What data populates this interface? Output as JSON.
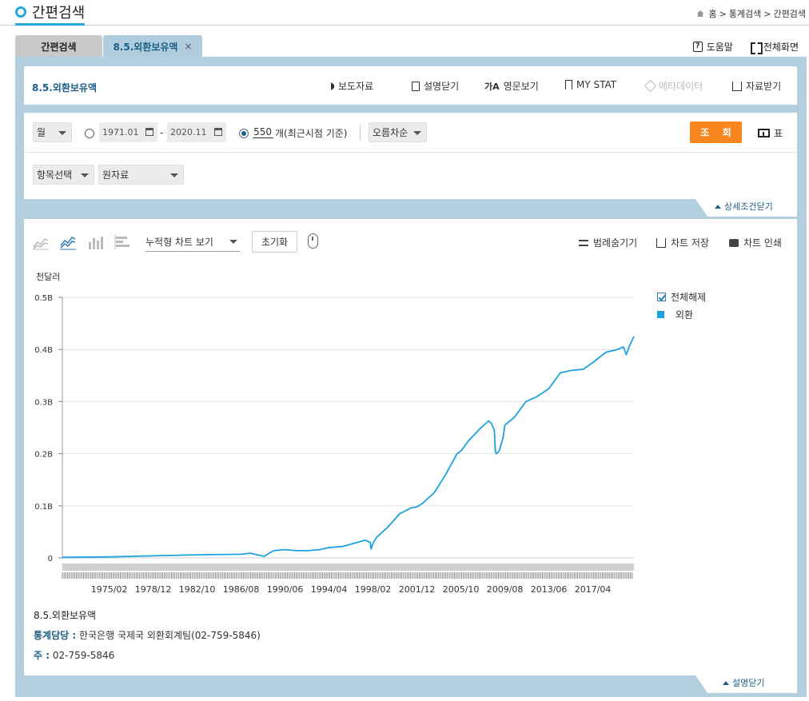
{
  "header": {
    "title": "간편검색",
    "breadcrumb": [
      "홈",
      "통계검색",
      "간편검색"
    ]
  },
  "tabs": [
    {
      "label": "간편검색",
      "active": false
    },
    {
      "label": "8.5.외환보유액",
      "active": true,
      "close": "×"
    }
  ],
  "top_actions": {
    "help": "도움말",
    "fullscreen": "전체화면"
  },
  "table_panel": {
    "title": "8.5.외환보유액",
    "tools": {
      "press": "보도자료",
      "desc_close": "설명닫기",
      "english": "영문보기",
      "my_stat": "MY STAT",
      "metadata": "메타데이터",
      "download": "자료받기"
    }
  },
  "query": {
    "period": "월",
    "date_from": "1971.01",
    "date_to": "2020.11",
    "date_separator": "-",
    "count": "550",
    "count_label": "개(최근시점 기준)",
    "sort": "오름차순",
    "search_button": "조 회",
    "table_button": "표",
    "item_select": "항목선택",
    "data_type": "원자료",
    "detail_toggle": "상세조건닫기"
  },
  "chart_toolbar": {
    "view_mode": "누적형 차트 보기",
    "reset": "초기화",
    "legend_hide": "범례숨기기",
    "save": "차트 저장",
    "print": "차트 인쇄"
  },
  "chart_data": {
    "type": "line",
    "ylabel": "천달러",
    "y_ticks": [
      "0",
      "0.1B",
      "0.2B",
      "0.3B",
      "0.4B",
      "0.5B"
    ],
    "ylim": [
      0,
      500000000
    ],
    "x_tick_labels": [
      "1975/02",
      "1978/12",
      "1982/10",
      "1986/08",
      "1990/06",
      "1994/04",
      "1998/02",
      "2001/12",
      "2005/10",
      "2009/08",
      "2013/06",
      "2017/04"
    ],
    "grid": true,
    "legend": {
      "select_all": "전체해제",
      "position": "right"
    },
    "series": [
      {
        "name": "외환",
        "color": "#1ca2e0",
        "x": [
          "1971/01",
          "1975/02",
          "1978/12",
          "1982/10",
          "1986/08",
          "1987/06",
          "1988/08",
          "1989/06",
          "1990/06",
          "1991/06",
          "1992/06",
          "1993/06",
          "1994/04",
          "1995/06",
          "1996/06",
          "1997/06",
          "1997/11",
          "1997/12",
          "1998/02",
          "1998/06",
          "1999/06",
          "2000/06",
          "2001/06",
          "2001/12",
          "2002/06",
          "2003/06",
          "2004/06",
          "2005/06",
          "2005/10",
          "2006/06",
          "2007/06",
          "2008/03",
          "2008/06",
          "2008/09",
          "2008/10",
          "2008/11",
          "2009/02",
          "2009/06",
          "2009/08",
          "2010/06",
          "2011/06",
          "2012/06",
          "2013/06",
          "2014/06",
          "2015/06",
          "2016/06",
          "2017/04",
          "2018/06",
          "2019/06",
          "2019/12",
          "2020/03",
          "2020/06",
          "2020/11"
        ],
        "values": [
          1000000,
          2000000,
          4000000,
          6000000,
          7000000,
          9000000,
          3000000,
          14000000,
          16000000,
          14000000,
          14000000,
          16000000,
          20000000,
          22000000,
          28000000,
          34000000,
          30000000,
          17000000,
          28000000,
          40000000,
          60000000,
          85000000,
          96000000,
          98000000,
          105000000,
          125000000,
          160000000,
          200000000,
          205000000,
          225000000,
          248000000,
          263000000,
          258000000,
          245000000,
          205000000,
          200000000,
          205000000,
          230000000,
          255000000,
          270000000,
          300000000,
          310000000,
          325000000,
          355000000,
          360000000,
          362000000,
          375000000,
          395000000,
          400000000,
          405000000,
          390000000,
          405000000,
          425000000
        ]
      }
    ]
  },
  "meta": {
    "title": "8.5.외환보유액",
    "contact_label": "통계담당 :",
    "contact_value": "한국은행 국제국 외환회계팀(02-759-5846)",
    "note_label": "주 :",
    "note_value": "02-759-5846",
    "close_desc": "설명닫기"
  }
}
